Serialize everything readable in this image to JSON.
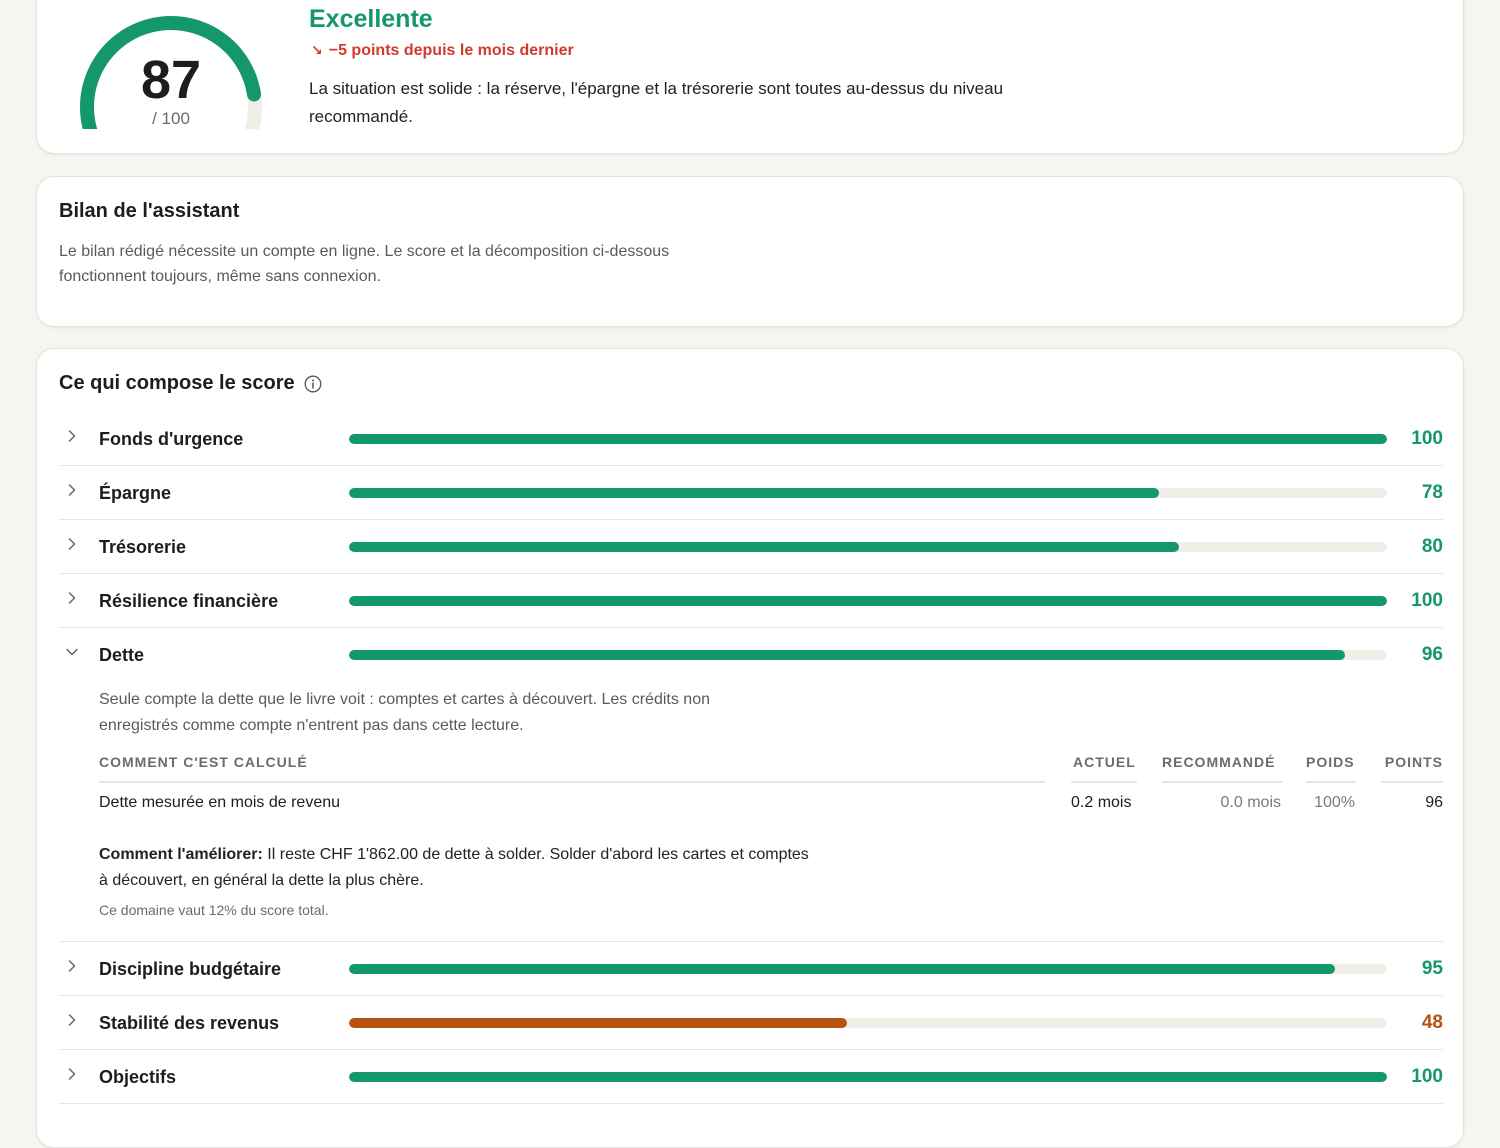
{
  "score": {
    "value": "87",
    "max_label": "/ 100",
    "fraction": 0.87,
    "rating": "Excellente",
    "trend": "−5 points depuis le mois dernier",
    "trend_icon": "arrow-down-right-icon",
    "summary": "La situation est solide : la réserve, l'épargne et la trésorerie sont toutes au-dessus du niveau recommandé."
  },
  "assistant": {
    "title": "Bilan de l'assistant",
    "text": "Le bilan rédigé nécessite un compte en ligne. Le score et la décomposition ci-dessous fonctionnent toujours, même sans connexion."
  },
  "breakdown": {
    "title": "Ce qui compose le score",
    "rows": [
      {
        "label": "Fonds d'urgence",
        "value": "100",
        "fraction": 1.0,
        "status": "good",
        "expanded": false
      },
      {
        "label": "Épargne",
        "value": "78",
        "fraction": 0.78,
        "status": "good",
        "expanded": false
      },
      {
        "label": "Trésorerie",
        "value": "80",
        "fraction": 0.8,
        "status": "good",
        "expanded": false
      },
      {
        "label": "Résilience financière",
        "value": "100",
        "fraction": 1.0,
        "status": "good",
        "expanded": false
      },
      {
        "label": "Dette",
        "value": "96",
        "fraction": 0.96,
        "status": "good",
        "expanded": true
      },
      {
        "label": "Discipline budgétaire",
        "value": "95",
        "fraction": 0.95,
        "status": "good",
        "expanded": false
      },
      {
        "label": "Stabilité des revenus",
        "value": "48",
        "fraction": 0.48,
        "status": "warn",
        "expanded": false
      },
      {
        "label": "Objectifs",
        "value": "100",
        "fraction": 1.0,
        "status": "good",
        "expanded": false
      }
    ],
    "detail": {
      "description": "Seule compte la dette que le livre voit : comptes et cartes à découvert. Les crédits non enregistrés comme compte n'entrent pas dans cette lecture.",
      "headers": {
        "calc": "COMMENT C'EST CALCULÉ",
        "current": "ACTUEL",
        "recommended": "RECOMMANDÉ",
        "weight": "POIDS",
        "points": "POINTS"
      },
      "row": {
        "metric": "Dette mesurée en mois de revenu",
        "current": "0.2 mois",
        "recommended": "0.0 mois",
        "weight": "100%",
        "points": "96"
      },
      "improve_label": "Comment l'améliorer:",
      "improve_text": " Il reste CHF 1'862.00 de dette à solder. Solder d'abord les cartes et comptes à découvert, en général la dette la plus chère.",
      "weight_note": "Ce domaine vaut 12% du score total."
    }
  },
  "colors": {
    "good": "#14976a",
    "warn": "#b8500f",
    "negative": "#d23a2e",
    "track": "#f0eee7"
  }
}
